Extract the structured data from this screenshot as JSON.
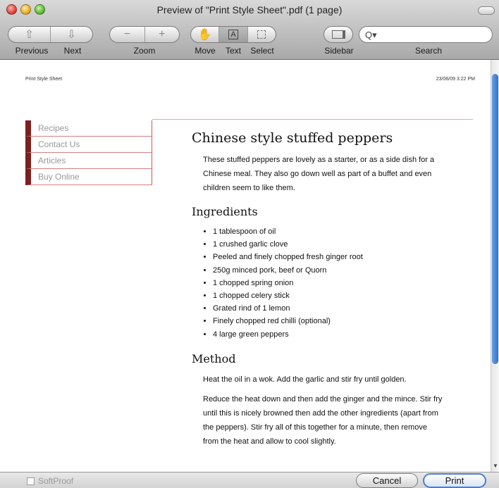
{
  "window": {
    "title": "Preview of \"Print Style Sheet\".pdf (1 page)"
  },
  "toolbar": {
    "labels": {
      "previous": "Previous",
      "next": "Next",
      "zoom": "Zoom",
      "move": "Move",
      "text": "Text",
      "select": "Select",
      "sidebar": "Sidebar",
      "search": "Search"
    },
    "search_value": "",
    "icons": {
      "previous": "up-arrow-icon",
      "next": "down-arrow-icon",
      "zoom_out": "minus-icon",
      "zoom_in": "plus-icon",
      "move": "hand-icon",
      "text": "text-cursor-icon",
      "select": "marquee-icon",
      "sidebar": "sidebar-icon",
      "search": "magnifier-icon"
    },
    "active_tool": "text"
  },
  "page": {
    "header_left": "Print Style Sheet",
    "header_right": "23/06/09 3:22 PM",
    "nav": [
      "Recipes",
      "Contact Us",
      "Articles",
      "Buy Online"
    ],
    "title": "Chinese style stuffed peppers",
    "intro": "These stuffed peppers are lovely as a starter, or as a side dish for a Chinese meal. They also go down well as part of a buffet and even children seem to like them.",
    "ingredients_heading": "Ingredients",
    "ingredients": [
      "1 tablespoon of oil",
      "1 crushed garlic clove",
      "Peeled and finely chopped fresh ginger root",
      "250g minced pork, beef or Quorn",
      "1 chopped spring onion",
      "1 chopped celery stick",
      "Grated rind of 1 lemon",
      "Finely chopped red chilli (optional)",
      "4 large green peppers"
    ],
    "method_heading": "Method",
    "method": [
      "Heat the oil in a wok. Add the garlic and stir fry until golden.",
      "Reduce the heat down and then add the ginger and the mince. Stir fry until this is nicely browned then add the other ingredients (apart from the peppers). Stir fry all of this together for a minute, then remove from the heat and allow to cool slightly."
    ]
  },
  "footer": {
    "softproof": "SoftProof",
    "cancel": "Cancel",
    "print": "Print"
  },
  "colors": {
    "nav_accent": "#7d1f1f",
    "rule": "#e3a8a8",
    "scroll_thumb": "#2f6fcf"
  }
}
